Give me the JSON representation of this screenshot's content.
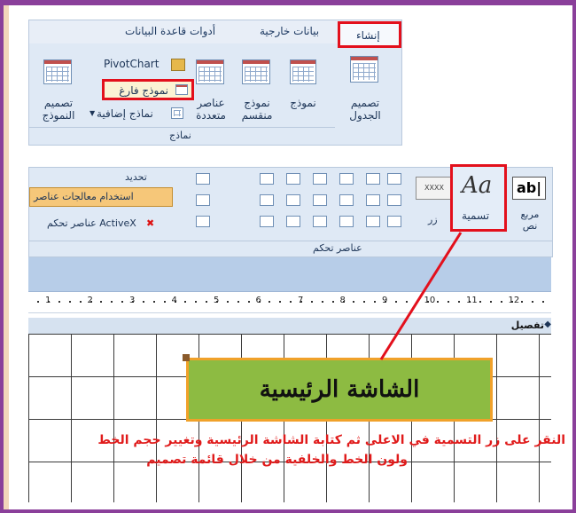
{
  "ribbon_top": {
    "tabs": [
      "إنشاء",
      "بيانات خارجية",
      "أدوات قاعدة البيانات"
    ],
    "active_tab": "إنشاء",
    "table_design": "تصميم الجدول",
    "form": "نموذج",
    "split_form": "نموذج منقسم",
    "multiple_items": "عناصر متعددة",
    "pivot_chart": "PivotChart",
    "blank_form": "نموذج فارغ",
    "more_forms": "نماذج إضافية",
    "form_design": "تصميم النموذج",
    "group_forms": "نماذج"
  },
  "ribbon_controls": {
    "select": "تحديد",
    "use_control_wizards": "استخدام معالجات عناصر",
    "activex": "عناصر تحكم ActiveX",
    "button": "زر",
    "label_control": "تسمية",
    "label_glyph": "Aa",
    "textbox": "مربع نص",
    "textbox_glyph": "ab|",
    "xxxx": "XXXX",
    "group_controls": "عناصر تحكم"
  },
  "ruler": {
    "numbers": [
      "1",
      "2",
      "3",
      "4",
      "5",
      "6",
      "7",
      "8",
      "9",
      "10",
      "11",
      "12"
    ]
  },
  "section": {
    "detail": "تفصيل"
  },
  "label_box": {
    "text": "الشاشة الرئيسية"
  },
  "instruction": {
    "line1": "النقر على زر التسمية في الاعلى ثم كتابة الشاشة الرئيسية وتغيير حجم الخط",
    "line2": "ولون الخط والخلفية من خلال قائمة تصميم"
  },
  "colors": {
    "frame": "#8a3f9a",
    "highlight": "#e3101c",
    "label_fill": "#8dbb42",
    "label_border": "#f0a12a",
    "note": "#e01b1b"
  }
}
